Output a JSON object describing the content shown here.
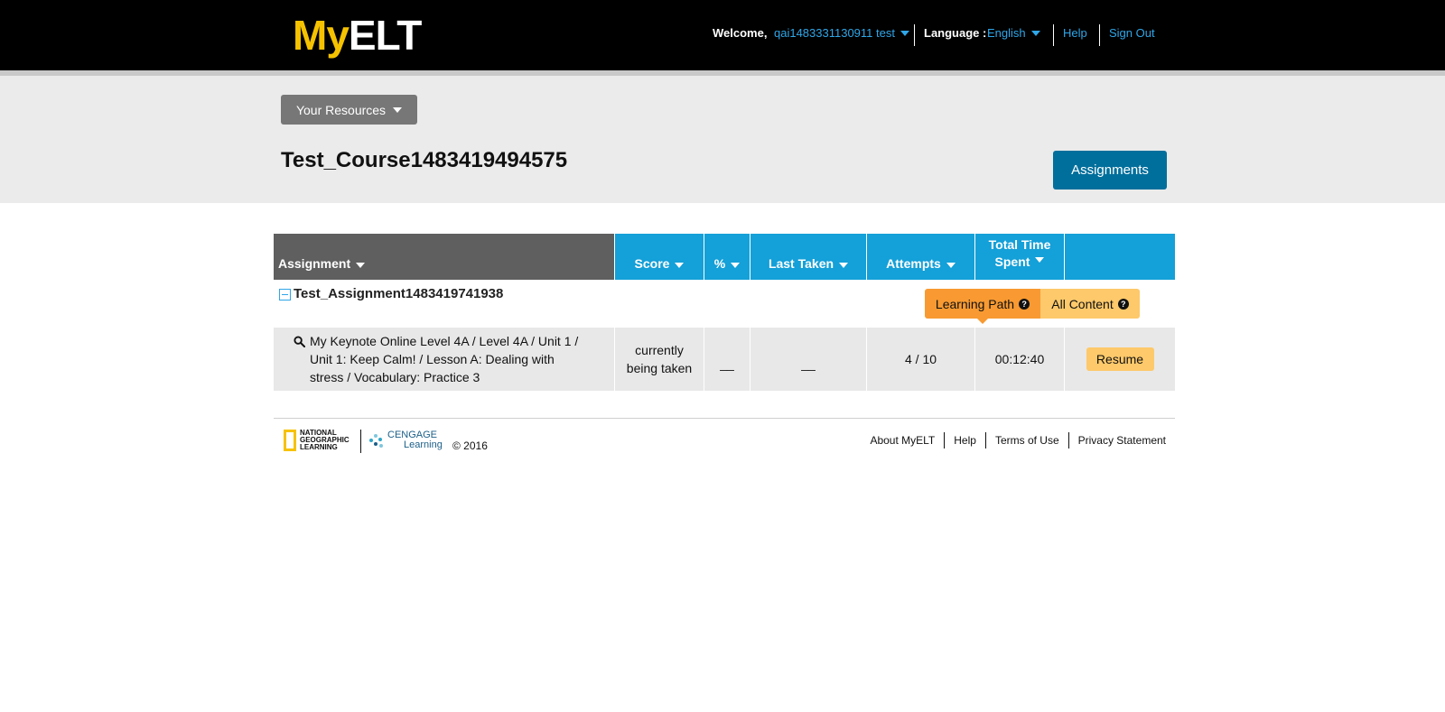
{
  "header": {
    "logo_my": "My",
    "logo_elt": "ELT",
    "welcome_label": "Welcome,",
    "username": "qai1483331130911 test",
    "language_label": "Language :",
    "language_value": "English",
    "help": "Help",
    "sign_out": "Sign Out"
  },
  "course": {
    "resources_button": "Your Resources",
    "title": "Test_Course1483419494575",
    "assignments_button": "Assignments"
  },
  "table": {
    "headers": {
      "assignment": "Assignment",
      "score": "Score",
      "percent": "%",
      "last_taken": "Last Taken",
      "attempts": "Attempts",
      "time_line1": "Total Time",
      "time_line2": "Spent"
    },
    "group": {
      "title": "Test_Assignment1483419741938",
      "learning_path": "Learning Path",
      "all_content": "All Content"
    },
    "rows": [
      {
        "assignment": "My Keynote Online Level 4A / Level 4A / Unit 1 / Unit 1: Keep Calm! / Lesson A: Dealing with stress / Vocabulary: Practice 3",
        "score": "currently being taken",
        "percent": "__",
        "last_taken": "__",
        "attempts": "4 / 10",
        "time": "00:12:40",
        "action": "Resume"
      }
    ]
  },
  "footer": {
    "ngl_line1": "NATIONAL",
    "ngl_line2": "GEOGRAPHIC",
    "ngl_line3": "LEARNING",
    "cengage_line1": "CENGAGE",
    "cengage_line2": "Learning",
    "copyright": "© 2016",
    "links": [
      "About MyELT",
      "Help",
      "Terms of Use",
      "Privacy Statement"
    ]
  },
  "colors": {
    "header_bg": "#000000",
    "logo_my": "#f6c200",
    "link_blue": "#2fa6e8",
    "table_header_blue": "#14a0d8",
    "table_header_gray": "#5f5f5f",
    "assignments_btn": "#006f9c",
    "learning_path": "#f89a31",
    "all_content": "#fdc96a"
  },
  "icons": [
    "chevron-down-icon",
    "collapse-icon",
    "search-icon",
    "help-circle-icon"
  ]
}
